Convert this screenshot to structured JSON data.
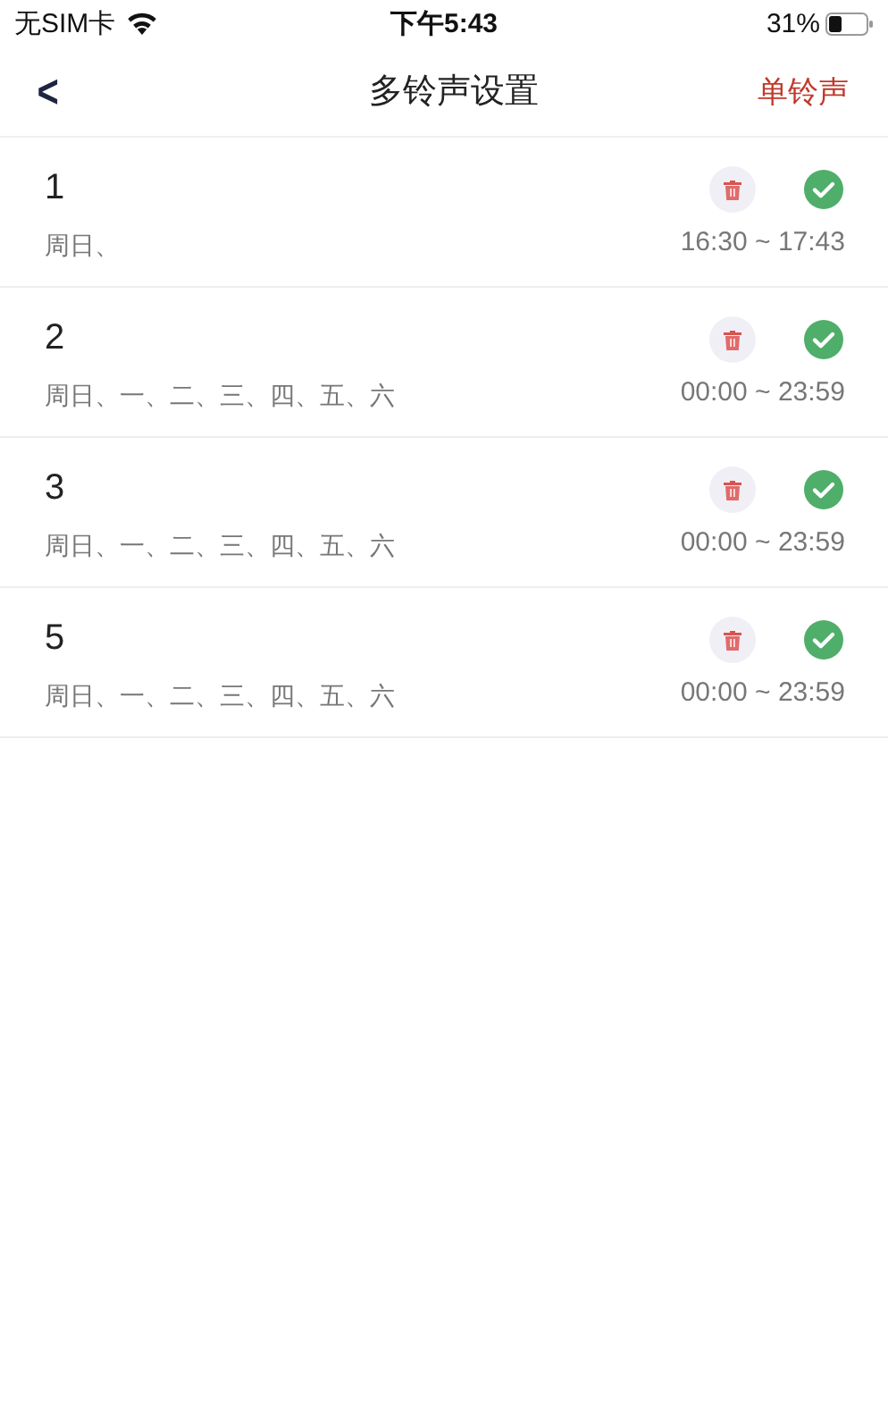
{
  "status_bar": {
    "carrier": "无SIM卡",
    "time": "下午5:43",
    "battery": "31%"
  },
  "nav": {
    "back": "<",
    "title": "多铃声设置",
    "action": "单铃声"
  },
  "rings": [
    {
      "name": "1",
      "days": "周日、",
      "time": "16:30 ~ 17:43",
      "checked": true
    },
    {
      "name": "2",
      "days": "周日、一、二、三、四、五、六",
      "time": "00:00 ~ 23:59",
      "checked": true
    },
    {
      "name": "3",
      "days": "周日、一、二、三、四、五、六",
      "time": "00:00 ~ 23:59",
      "checked": true
    },
    {
      "name": "5",
      "days": "周日、一、二、三、四、五、六",
      "time": "00:00 ~ 23:59",
      "checked": true
    }
  ]
}
